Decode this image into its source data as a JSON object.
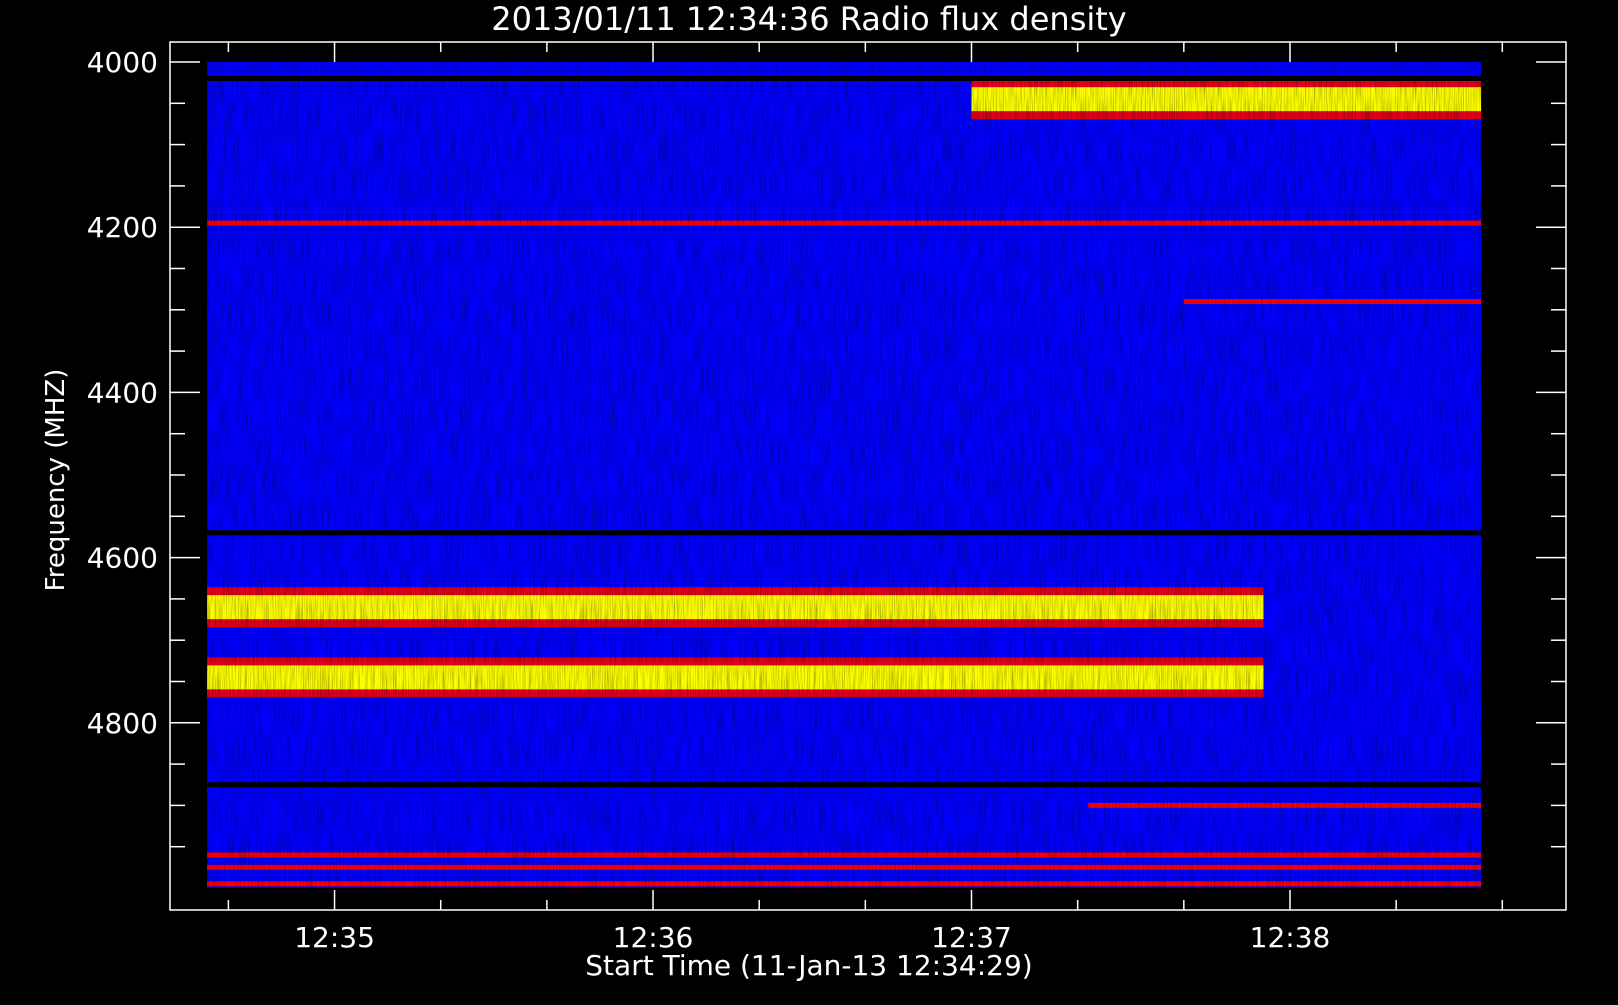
{
  "chart_data": {
    "type": "heatmap",
    "title": "2013/01/11 12:34:36 Radio flux density",
    "xlabel": "Start Time (11-Jan-13 12:34:29)",
    "ylabel": "Frequency (MHZ)",
    "x_range": [
      "12:34:36",
      "12:38:36"
    ],
    "xlim": [
      "12:34:29",
      "12:38:52"
    ],
    "x_ticks": [
      "12:35",
      "12:36",
      "12:37",
      "12:38"
    ],
    "ylim": [
      4000,
      5000
    ],
    "y_range": [
      4000,
      5000
    ],
    "y_ticks": [
      4000,
      4200,
      4400,
      4600,
      4800
    ],
    "y_reversed": true,
    "colormap": [
      "#000000",
      "#0000ff",
      "#ff0000",
      "#ffff00",
      "#ffffff"
    ],
    "background_color": "#0000ff",
    "features": [
      {
        "kind": "band",
        "freq": 4045,
        "t_start": "12:37:00",
        "t_end": "12:38:36",
        "level": "bright"
      },
      {
        "kind": "band",
        "freq": 4020,
        "t_start": "12:34:36",
        "t_end": "12:38:36",
        "level": "dark"
      },
      {
        "kind": "band",
        "freq": 4195,
        "t_start": "12:34:36",
        "t_end": "12:38:36",
        "level": "red"
      },
      {
        "kind": "band",
        "freq": 4290,
        "t_start": "12:37:40",
        "t_end": "12:38:36",
        "level": "red"
      },
      {
        "kind": "band",
        "freq": 4570,
        "t_start": "12:34:36",
        "t_end": "12:38:36",
        "level": "dark"
      },
      {
        "kind": "band",
        "freq": 4660,
        "t_start": "12:34:36",
        "t_end": "12:37:55",
        "level": "bright"
      },
      {
        "kind": "band",
        "freq": 4745,
        "t_start": "12:34:36",
        "t_end": "12:37:55",
        "level": "bright"
      },
      {
        "kind": "band",
        "freq": 4875,
        "t_start": "12:34:36",
        "t_end": "12:38:36",
        "level": "dark"
      },
      {
        "kind": "band",
        "freq": 4900,
        "t_start": "12:37:22",
        "t_end": "12:38:36",
        "level": "red"
      },
      {
        "kind": "band",
        "freq": 4960,
        "t_start": "12:34:36",
        "t_end": "12:38:36",
        "level": "red"
      },
      {
        "kind": "band",
        "freq": 4975,
        "t_start": "12:34:36",
        "t_end": "12:38:36",
        "level": "red"
      },
      {
        "kind": "band",
        "freq": 4995,
        "t_start": "12:34:36",
        "t_end": "12:38:36",
        "level": "red"
      }
    ]
  }
}
